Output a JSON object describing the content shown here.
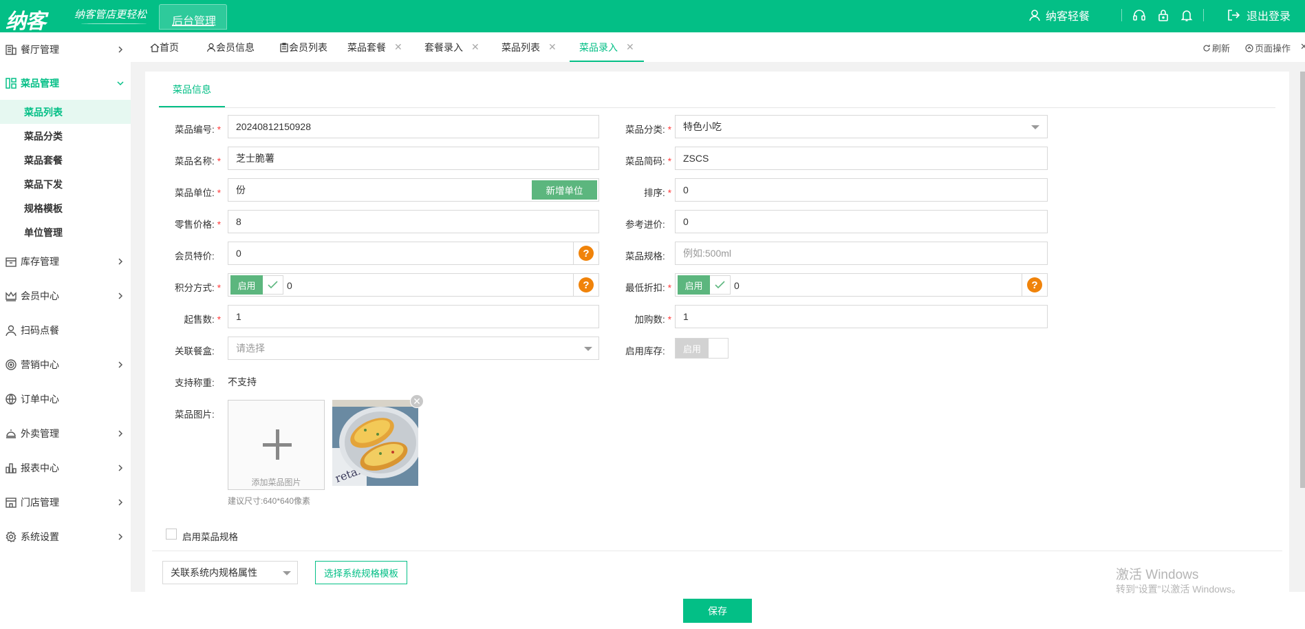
{
  "brand": {
    "logo": "纳客",
    "slogan": "纳客管店更轻松",
    "admin_tab": "后台管理"
  },
  "topbar": {
    "user_name": "纳客轻餐",
    "logout": "退出登录",
    "icons": [
      "headset-icon",
      "lock-icon",
      "bell-icon"
    ]
  },
  "sidebar": {
    "items": [
      {
        "label": "餐厅管理",
        "icon": "store-icon"
      },
      {
        "label": "菜品管理",
        "icon": "dishes-icon"
      },
      {
        "label": "库存管理",
        "icon": "inventory-icon"
      },
      {
        "label": "会员中心",
        "icon": "crown-icon"
      },
      {
        "label": "扫码点餐",
        "icon": "user-icon"
      },
      {
        "label": "营销中心",
        "icon": "target-icon"
      },
      {
        "label": "订单中心",
        "icon": "globe-icon"
      },
      {
        "label": "外卖管理",
        "icon": "cloche-icon"
      },
      {
        "label": "报表中心",
        "icon": "report-icon"
      },
      {
        "label": "门店管理",
        "icon": "shop-icon"
      },
      {
        "label": "系统设置",
        "icon": "gear-icon"
      }
    ],
    "sub_items": [
      "菜品列表",
      "菜品分类",
      "菜品套餐",
      "菜品下发",
      "规格模板",
      "单位管理"
    ]
  },
  "tabs": [
    {
      "label": "首页"
    },
    {
      "label": "会员信息"
    },
    {
      "label": "会员列表"
    },
    {
      "label": "菜品套餐"
    },
    {
      "label": "套餐录入"
    },
    {
      "label": "菜品列表"
    },
    {
      "label": "菜品录入"
    }
  ],
  "tab_actions": {
    "refresh": "刷新",
    "page_ops": "页面操作"
  },
  "form": {
    "section_tab": "菜品信息",
    "code_label": "菜品编号:",
    "code_value": "20240812150928",
    "category_label": "菜品分类:",
    "category_value": "特色小吃",
    "name_label": "菜品名称:",
    "name_value": "芝士脆薯",
    "short_code_label": "菜品简码:",
    "short_code_value": "ZSCS",
    "unit_label": "菜品单位:",
    "unit_value": "份",
    "add_unit_button": "新增单位",
    "sort_label": "排序:",
    "sort_value": "0",
    "retail_price_label": "零售价格:",
    "retail_price_value": "8",
    "ref_price_label": "参考进价:",
    "ref_price_value": "0",
    "member_price_label": "会员特价:",
    "member_price_value": "0",
    "spec_label": "菜品规格:",
    "spec_placeholder": "例如:500ml",
    "points_label": "积分方式:",
    "points_toggle": "启用",
    "points_value": "0",
    "discount_label": "最低折扣:",
    "discount_toggle": "启用",
    "discount_value": "0",
    "min_sale_label": "起售数:",
    "min_sale_value": "1",
    "add_buy_label": "加购数:",
    "add_buy_value": "1",
    "box_label": "关联餐盒:",
    "box_placeholder": "请选择",
    "stock_label": "启用库存:",
    "stock_toggle": "启用",
    "weigh_label": "支持称重:",
    "weigh_value": "不支持",
    "image_label": "菜品图片:",
    "upload_text": "添加菜品图片",
    "image_hint": "建议尺寸:640*640像素",
    "enable_spec_label": "启用菜品规格",
    "attr_select": "关联系统内规格属性",
    "template_button": "选择系统规格模板",
    "help_glyph": "?"
  },
  "save_button": "保存",
  "watermark": {
    "line1": "激活 Windows",
    "line2": "转到“设置”以激活 Windows。"
  },
  "colors": {
    "brand": "#03bf86",
    "toggle": "#5cb67e",
    "help": "#f0830a",
    "required": "#ff3b3b"
  }
}
